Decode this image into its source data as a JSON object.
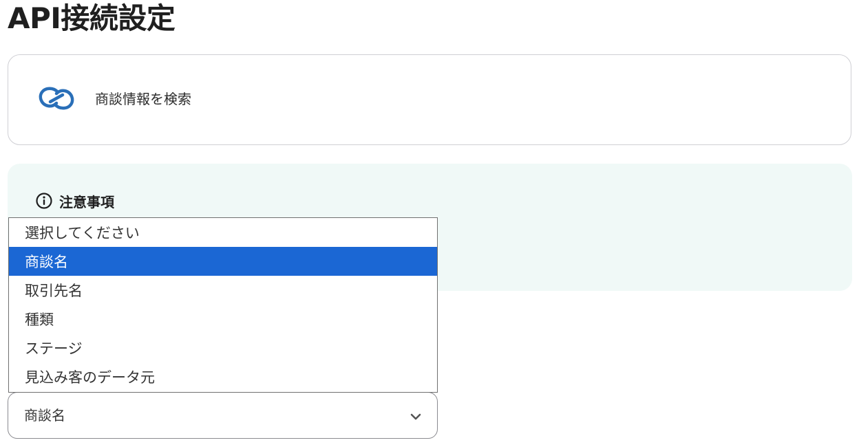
{
  "page": {
    "title": "API接続設定"
  },
  "action": {
    "label": "商談情報を検索",
    "icon": "zoho-crm-logo-icon",
    "icon_color": "#2a6fb8"
  },
  "notice": {
    "title": "注意事項",
    "icon": "info-icon",
    "background": "#f0f9f7"
  },
  "dropdown": {
    "options": [
      {
        "label": "選択してください",
        "selected": false
      },
      {
        "label": "商談名",
        "selected": true
      },
      {
        "label": "取引先名",
        "selected": false
      },
      {
        "label": "種類",
        "selected": false
      },
      {
        "label": "ステージ",
        "selected": false
      },
      {
        "label": "見込み客のデータ元",
        "selected": false
      }
    ],
    "highlight_color": "#1b67d4"
  },
  "select": {
    "value": "商談名",
    "icon": "chevron-down-icon"
  }
}
